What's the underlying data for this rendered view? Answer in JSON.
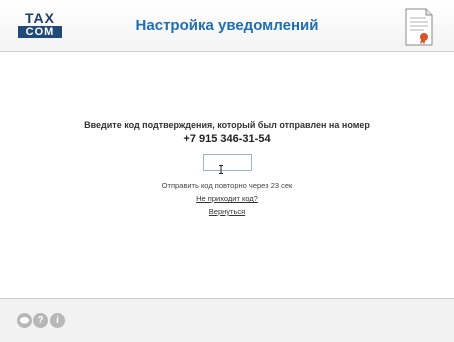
{
  "header": {
    "logo_top": "TAX",
    "logo_bottom": "COM",
    "title": "Настройка уведомлений"
  },
  "main": {
    "prompt": "Введите код подтверждения, который был отправлен на номер",
    "phone": "+7 915 346-31-54",
    "code_value": "",
    "resend_text": "Отправить код повторно через 23 сек",
    "no_code_link": "Не приходит код?",
    "back_link": "Вернуться"
  },
  "footer": {
    "icons": [
      "chat-icon",
      "help-icon",
      "info-icon"
    ],
    "help_glyph": "?",
    "info_glyph": "i"
  },
  "colors": {
    "title": "#1f6fb1",
    "logo": "#1f4a7a",
    "footer_icons": "#b7b7b7"
  }
}
